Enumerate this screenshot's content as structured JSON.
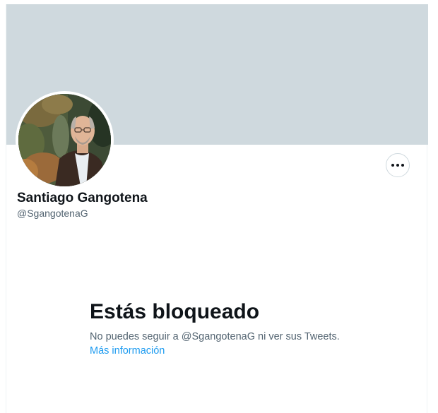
{
  "profile": {
    "display_name": "Santiago Gangotena",
    "handle": "@SgangotenaG",
    "banner_color": "#cfd9de",
    "avatar_alt": "profile-photo",
    "more_button_icon": "more-horizontal-icon"
  },
  "blocked": {
    "title": "Estás bloqueado",
    "description": "No puedes seguir a @SgangotenaG ni ver sus Tweets.",
    "link_label": "Más información"
  },
  "colors": {
    "primary_text": "#0f1419",
    "secondary_text": "#536471",
    "link": "#1d9bf0",
    "border": "#cfd9de"
  }
}
